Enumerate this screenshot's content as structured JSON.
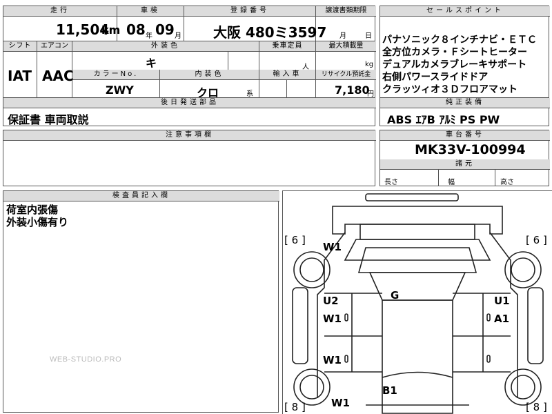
{
  "top_row": {
    "mileage_label": "走行",
    "mileage_value": "11,504",
    "mileage_unit": "km",
    "inspection_label": "車検",
    "inspection_year": "08",
    "inspection_year_unit": "年",
    "inspection_month": "09",
    "inspection_month_unit": "月",
    "registration_label": "登録番号",
    "registration_value": "大阪 480ミ3597",
    "transfer_label": "譲渡書類期限",
    "transfer_month": "月",
    "transfer_day": "日"
  },
  "selling_points": {
    "title": "セールスポイント",
    "lines": [
      "パナソニック８インチナビ・ＥＴＣ",
      "全方位カメラ・Ｆシートヒーター",
      "デュアルカメラブレーキサポート",
      "右側パワースライドドア",
      "クラッツィオ３Ｄフロアマット"
    ]
  },
  "second_row": {
    "shift_label": "シフト",
    "shift_value": "IAT",
    "ac_label": "エアコン",
    "ac_value": "AAC",
    "exterior_label": "外装色",
    "exterior_value": "キ",
    "capacity_label": "乗車定員",
    "capacity_unit": "人",
    "load_label": "最大積載量",
    "load_unit": "kg",
    "color_no_label": "カラーNo.",
    "color_no_value": "ZWY",
    "interior_label": "内装色",
    "interior_value": "クロ",
    "interior_unit": "系",
    "import_label": "輸入車",
    "recycle_label": "リサイクル預託金",
    "recycle_value": "7,180",
    "recycle_unit": "円"
  },
  "later_parts": {
    "title": "後日発送部品",
    "value": "保証書 車両取説"
  },
  "genuine": {
    "title": "純正装備",
    "value": "ABS ｴｱB ｱﾙﾐ PS PW"
  },
  "notes": {
    "title": "注意事項欄"
  },
  "chassis": {
    "title": "車台番号",
    "value": "MK33V-100994",
    "dims_title": "諸元",
    "length_label": "長さ",
    "width_label": "幅",
    "height_label": "高さ"
  },
  "inspector": {
    "title": "検査員記入欄",
    "lines": [
      "荷室内張傷",
      "外装小傷有り"
    ]
  },
  "diagram": {
    "tire_fl": "6",
    "tire_fr": "6",
    "tire_rl": "8",
    "tire_rr": "8",
    "mark_front_left_fender": "W1",
    "mark_left_front_door_u": "U2",
    "mark_left_front_door_w": "W1",
    "mark_left_rear_door": "W1",
    "mark_left_rear_fender": "W1",
    "mark_windshield": "G",
    "mark_right_front_door_u": "U1",
    "mark_right_front_door_a": "A1",
    "mark_back": "B1"
  },
  "watermark": "WEB-STUDIO.PRO"
}
